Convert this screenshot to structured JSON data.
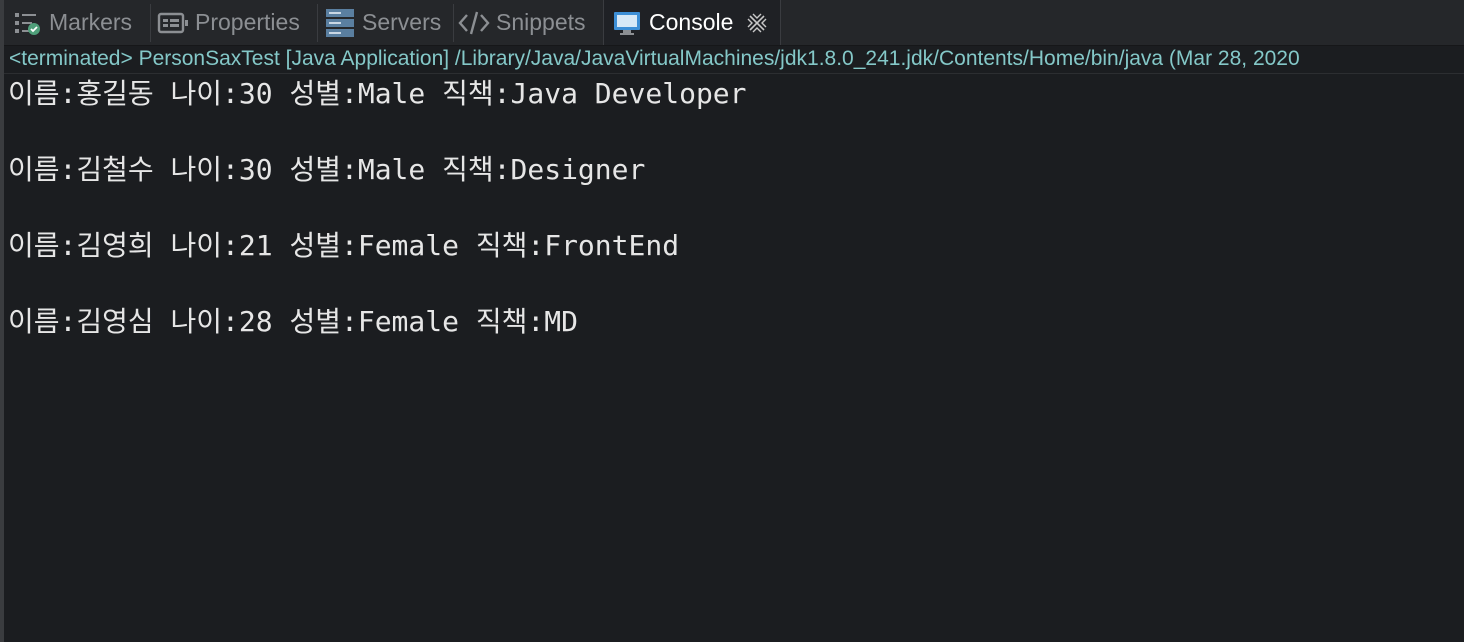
{
  "tabs": [
    {
      "label": "Markers",
      "icon": "markers-icon",
      "active": false
    },
    {
      "label": "Properties",
      "icon": "properties-icon",
      "active": false
    },
    {
      "label": "Servers",
      "icon": "servers-icon",
      "active": false
    },
    {
      "label": "Snippets",
      "icon": "snippets-icon",
      "active": false
    },
    {
      "label": "Console",
      "icon": "console-icon",
      "active": true,
      "close_icon": "close-icon"
    }
  ],
  "status": "<terminated> PersonSaxTest [Java Application] /Library/Java/JavaVirtualMachines/jdk1.8.0_241.jdk/Contents/Home/bin/java (Mar 28, 2020",
  "output": [
    "이름:홍길동 나이:30 성별:Male 직책:Java Developer",
    "이름:김철수 나이:30 성별:Male 직책:Designer",
    "이름:김영희 나이:21 성별:Female 직책:FrontEnd",
    "이름:김영심 나이:28 성별:Female 직책:MD"
  ],
  "colors": {
    "background": "#1b1d20",
    "tabbar": "#25272a",
    "status_text": "#84c8c8",
    "output_text": "#e6e6e6",
    "console_icon": "#3d8fd6"
  }
}
